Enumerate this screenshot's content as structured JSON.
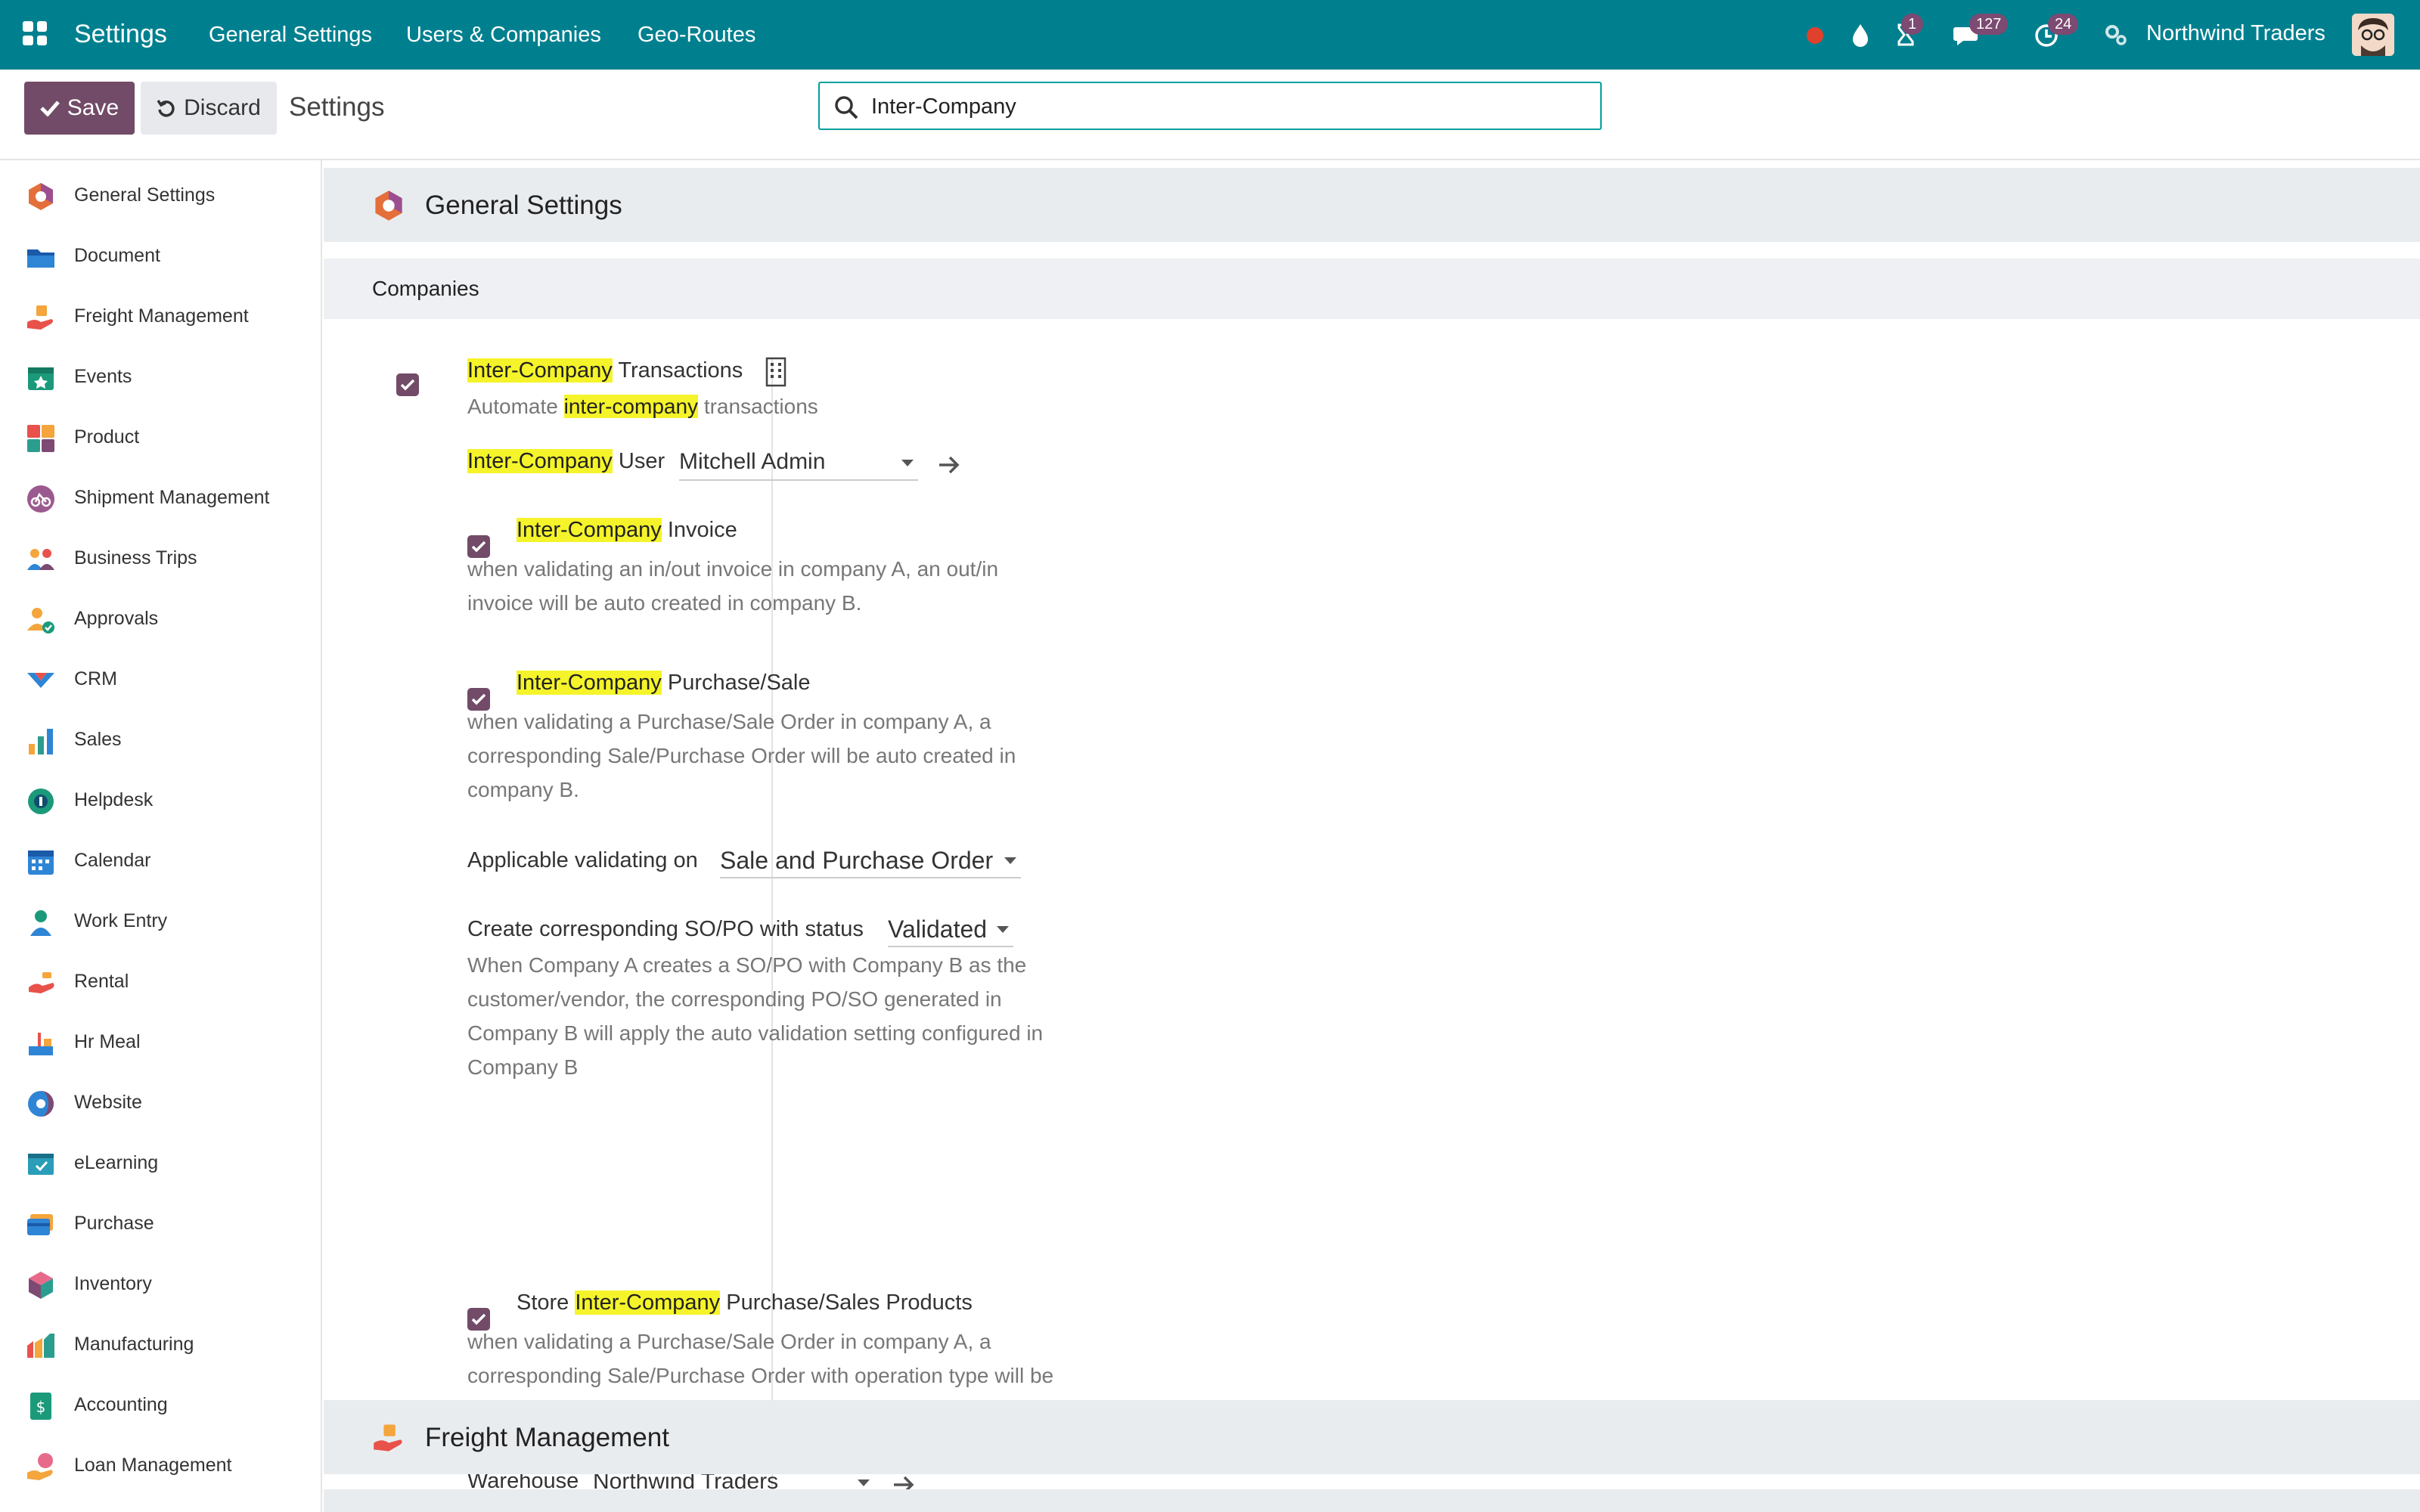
{
  "navbar": {
    "brand": "Settings",
    "menus": [
      "General Settings",
      "Users & Companies",
      "Geo-Routes"
    ],
    "activity_badge": "1",
    "messages_badge": "127",
    "clock_badge": "24",
    "company": "Northwind Traders"
  },
  "control_panel": {
    "save_label": "Save",
    "discard_label": "Discard",
    "title": "Settings",
    "search_value": "Inter-Company"
  },
  "sidebar": {
    "items": [
      {
        "label": "General Settings",
        "icon": "general-settings-icon"
      },
      {
        "label": "Document",
        "icon": "folder-icon"
      },
      {
        "label": "Freight Management",
        "icon": "freight-icon"
      },
      {
        "label": "Events",
        "icon": "calendar-star-icon"
      },
      {
        "label": "Product",
        "icon": "product-icon"
      },
      {
        "label": "Shipment Management",
        "icon": "shipment-icon"
      },
      {
        "label": "Business Trips",
        "icon": "people-icon"
      },
      {
        "label": "Approvals",
        "icon": "approval-icon"
      },
      {
        "label": "CRM",
        "icon": "crm-icon"
      },
      {
        "label": "Sales",
        "icon": "sales-chart-icon"
      },
      {
        "label": "Helpdesk",
        "icon": "helpdesk-icon"
      },
      {
        "label": "Calendar",
        "icon": "calendar-icon"
      },
      {
        "label": "Work Entry",
        "icon": "work-entry-icon"
      },
      {
        "label": "Rental",
        "icon": "rental-icon"
      },
      {
        "label": "Hr Meal",
        "icon": "meal-icon"
      },
      {
        "label": "Website",
        "icon": "website-icon"
      },
      {
        "label": "eLearning",
        "icon": "elearning-icon"
      },
      {
        "label": "Purchase",
        "icon": "purchase-card-icon"
      },
      {
        "label": "Inventory",
        "icon": "inventory-box-icon"
      },
      {
        "label": "Manufacturing",
        "icon": "manufacturing-icon"
      },
      {
        "label": "Accounting",
        "icon": "accounting-icon"
      },
      {
        "label": "Loan Management",
        "icon": "loan-icon"
      }
    ]
  },
  "main": {
    "app_header": "General Settings",
    "section": "Companies",
    "ict": {
      "hl": "Inter-Company",
      "rest": " Transactions",
      "desc_pre": "Automate ",
      "desc_hl": "inter-company",
      "desc_post": " transactions"
    },
    "user_field": {
      "hl": "Inter-Company",
      "rest": " User",
      "value": "Mitchell Admin"
    },
    "invoice": {
      "hl": "Inter-Company",
      "rest": " Invoice",
      "desc": "when validating an in/out invoice in company A, an out/in invoice will be auto created in company B."
    },
    "purchase_sale": {
      "hl": "Inter-Company",
      "rest": " Purchase/Sale",
      "desc": "when validating a Purchase/Sale Order in company A, a corresponding Sale/Purchase Order will be auto created in company B."
    },
    "applicable": {
      "label": "Applicable validating on",
      "value": "Sale and Purchase Order"
    },
    "status": {
      "label": "Create corresponding SO/PO with status",
      "value": "Validated",
      "desc": "When Company A creates a SO/PO with Company B as the customer/vendor, the corresponding PO/SO generated in Company B will apply the auto validation setting configured in Company B"
    },
    "store": {
      "pre": "Store ",
      "hl": "Inter-Company",
      "rest": " Purchase/Sales Products",
      "desc": "when validating a Purchase/Sale Order in company A, a corresponding Sale/Purchase Order with operation type will be auto created in company B."
    },
    "warehouse": {
      "label": "Warehouse",
      "value": "Northwind Traders"
    },
    "next_app_header": "Freight Management"
  },
  "colors": {
    "navbar": "#00808f",
    "primary": "#714b67",
    "highlight": "#f5f42a"
  }
}
